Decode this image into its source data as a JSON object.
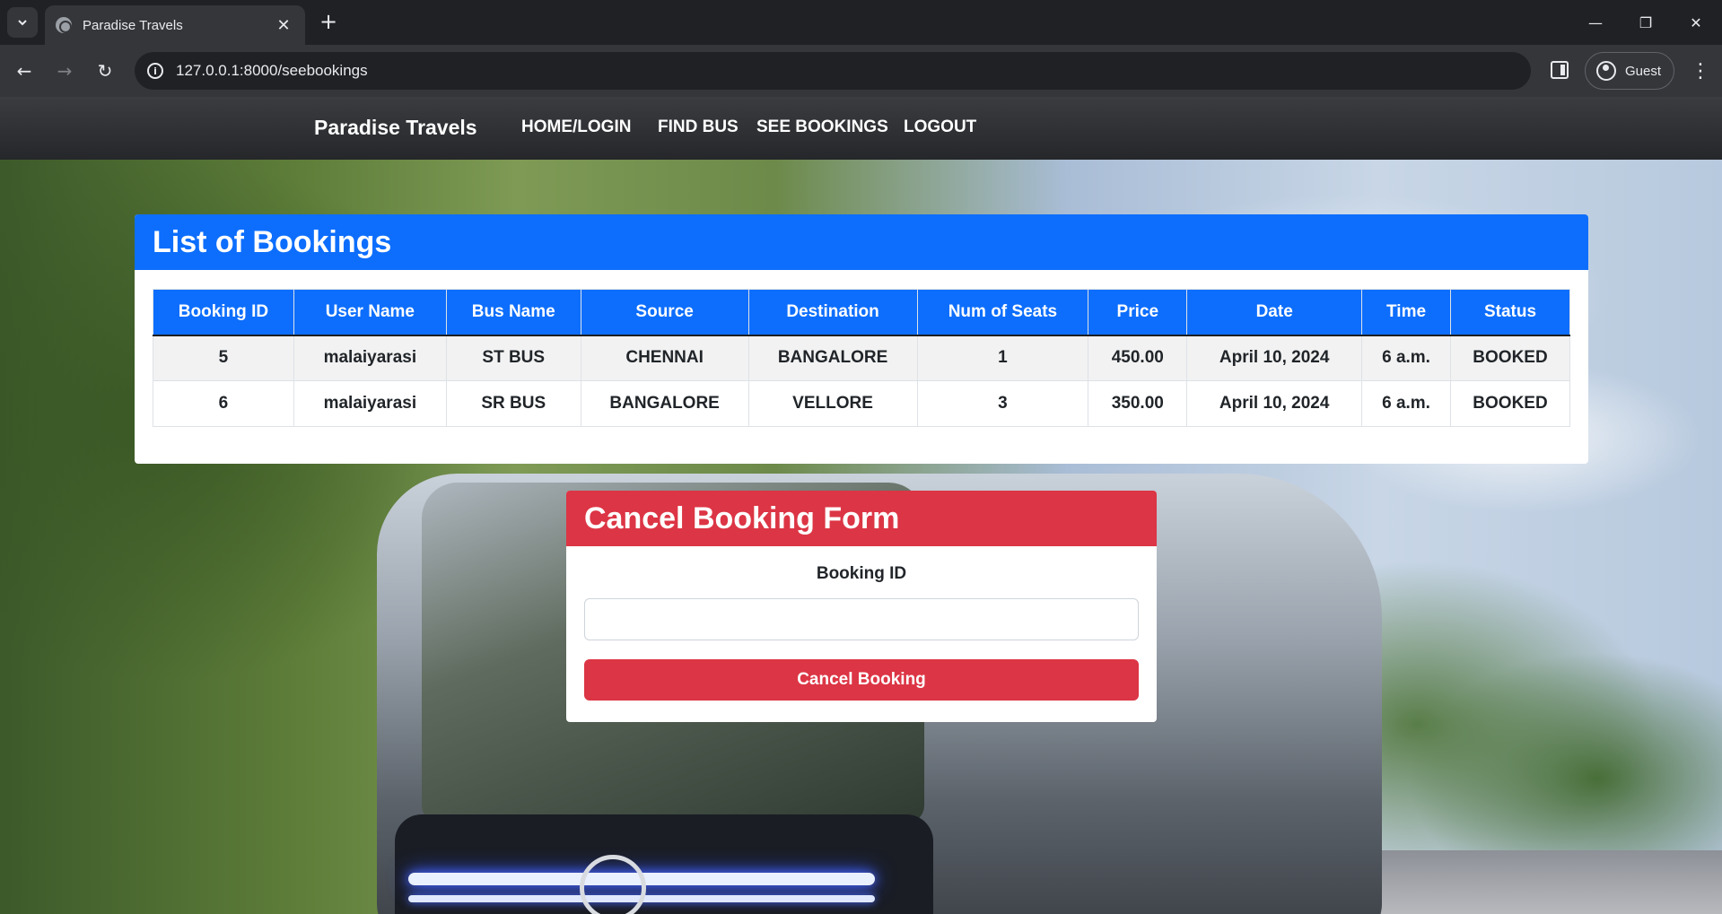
{
  "browser": {
    "tab_title": "Paradise Travels",
    "url": "127.0.0.1:8000/seebookings",
    "profile_label": "Guest"
  },
  "nav": {
    "brand": "Paradise Travels",
    "links": [
      "HOME/LOGIN",
      "FIND BUS",
      "SEE BOOKINGS",
      "LOGOUT"
    ]
  },
  "bookings": {
    "title": "List of Bookings",
    "columns": [
      "Booking ID",
      "User Name",
      "Bus Name",
      "Source",
      "Destination",
      "Num of Seats",
      "Price",
      "Date",
      "Time",
      "Status"
    ],
    "rows": [
      [
        "5",
        "malaiyarasi",
        "ST BUS",
        "CHENNAI",
        "BANGALORE",
        "1",
        "450.00",
        "April 10, 2024",
        "6 a.m.",
        "BOOKED"
      ],
      [
        "6",
        "malaiyarasi",
        "SR BUS",
        "BANGALORE",
        "VELLORE",
        "3",
        "350.00",
        "April 10, 2024",
        "6 a.m.",
        "BOOKED"
      ]
    ]
  },
  "cancel_form": {
    "title": "Cancel Booking Form",
    "field_label": "Booking ID",
    "field_value": "",
    "button_label": "Cancel Booking"
  },
  "colors": {
    "primary": "#0d6efd",
    "danger": "#dc3545",
    "navbar": "#2b2d30"
  },
  "icons": [
    "tab-search-icon",
    "globe-icon",
    "close-icon",
    "plus-icon",
    "minimize-icon",
    "restore-icon",
    "back-arrow-icon",
    "forward-arrow-icon",
    "reload-icon",
    "info-icon",
    "side-panel-icon",
    "profile-icon",
    "kebab-menu-icon"
  ]
}
